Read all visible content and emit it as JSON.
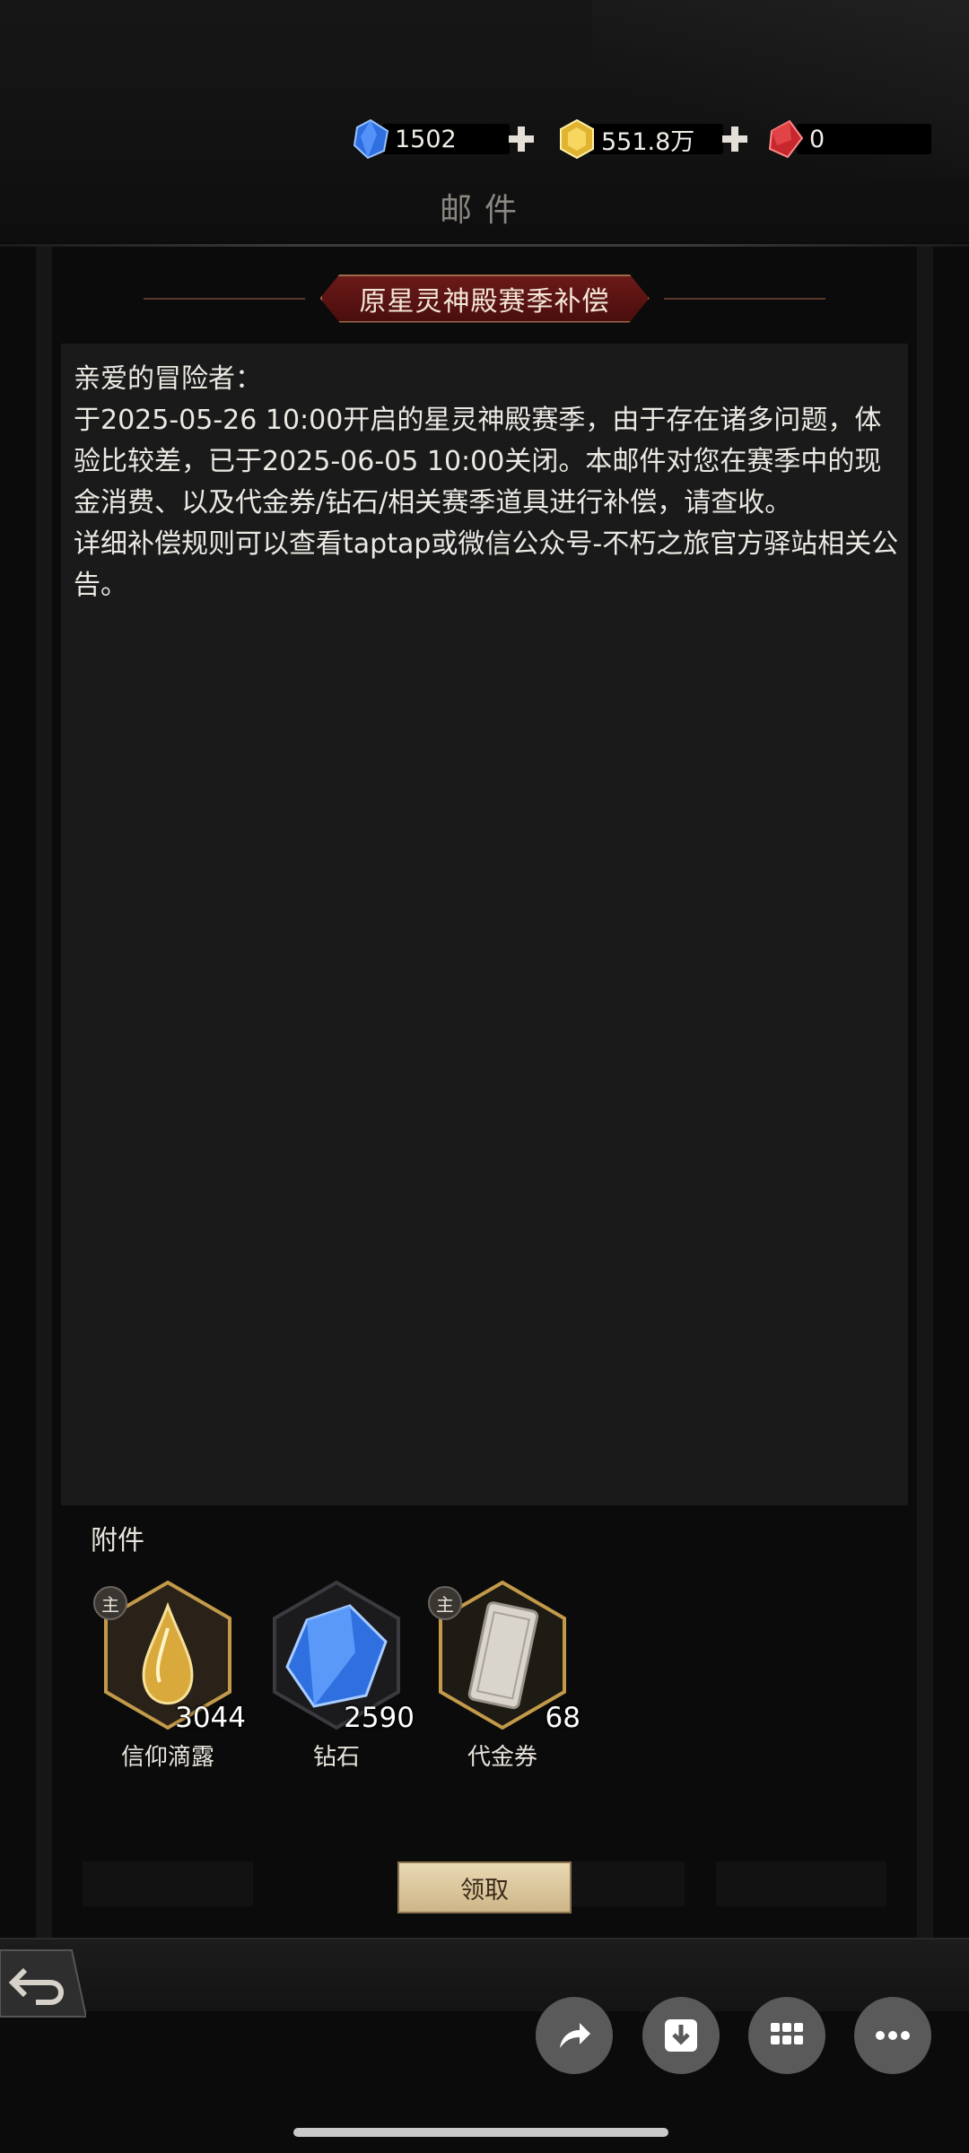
{
  "header": {
    "currencies": [
      {
        "icon": "blue-diamond-icon",
        "value": "1502",
        "has_plus": true
      },
      {
        "icon": "gold-coin-icon",
        "value": "551.8万",
        "has_plus": true
      },
      {
        "icon": "red-crystal-icon",
        "value": "0",
        "has_plus": false
      }
    ],
    "title": "邮件"
  },
  "mail": {
    "subject": "原星灵神殿赛季补偿",
    "body": "亲爱的冒险者：\n于2025-05-26 10:00开启的星灵神殿赛季，由于存在诸多问题，体验比较差，已于2025-06-05 10:00关闭。本邮件对您在赛季中的现金消费、以及代金券/钻石/相关赛季道具进行补偿，请查收。\n详细补偿规则可以查看taptap或微信公众号-不朽之旅官方驿站相关公告。",
    "attachment_label": "附件",
    "attachments": [
      {
        "name": "信仰滴露",
        "count": "3044",
        "badge": "主",
        "icon": "faith-dew-icon"
      },
      {
        "name": "钻石",
        "count": "2590",
        "badge": "",
        "icon": "diamond-icon"
      },
      {
        "name": "代金券",
        "count": "68",
        "badge": "主",
        "icon": "voucher-icon"
      }
    ],
    "claim_label": "领取"
  },
  "colors": {
    "background": "#0b0b0b",
    "banner": "#6b1a18",
    "claim_button": "#e9d9b3",
    "gold_frame": "#c29a4a"
  }
}
